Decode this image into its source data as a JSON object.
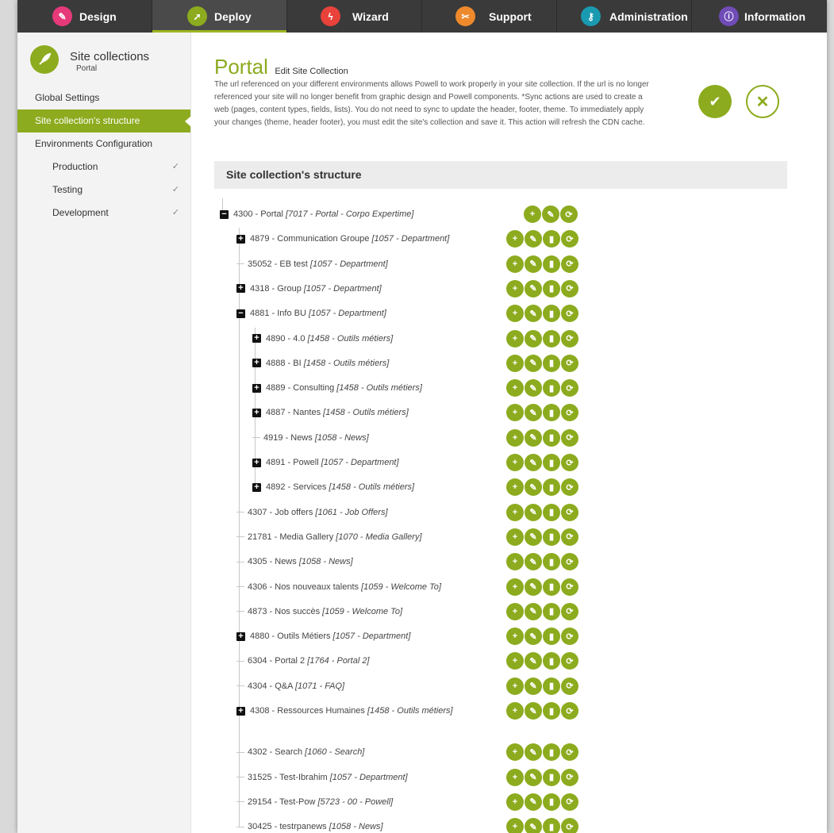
{
  "nav": {
    "tabs": [
      {
        "label": "Design",
        "icon": "wand-icon",
        "color": "#e6397a"
      },
      {
        "label": "Deploy",
        "icon": "rocket-icon",
        "color": "#8cab1e"
      },
      {
        "label": "Wizard",
        "icon": "lightning-icon",
        "color": "#e8423a"
      },
      {
        "label": "Support",
        "icon": "ticket-icon",
        "color": "#ee8a2c"
      },
      {
        "label": "Administration",
        "icon": "key-icon",
        "color": "#1a9ab0"
      },
      {
        "label": "Information",
        "icon": "info-icon",
        "color": "#6f4cb6"
      }
    ],
    "active": "Deploy"
  },
  "sidebar": {
    "title": "Site collections",
    "subtitle": "Portal",
    "items": [
      {
        "label": "Global Settings"
      },
      {
        "label": "Site collection's structure",
        "active": true
      },
      {
        "label": "Environments Configuration"
      },
      {
        "label": "Production",
        "check": "✓"
      },
      {
        "label": "Testing",
        "check": "✓"
      },
      {
        "label": "Development",
        "check": "✓"
      }
    ]
  },
  "main": {
    "title": "Portal",
    "subtitle": "Edit Site Collection",
    "description": "The url referenced on your different environments allows Powell to work properly in your site collection. If the url is no longer referenced your site will no longer benefit from graphic design and Powell components. *Sync actions are used to create a web (pages, content types, fields, lists). You do not need to sync to update the header, footer, theme. To immediately apply your changes (theme, header footer), you must edit the site's collection and save it. This action will refresh the CDN cache.",
    "section_title": "Site collection's structure"
  },
  "tree": {
    "nodes": [
      {
        "id": "4300",
        "name": "Portal",
        "cat": "[7017 - Portal - Corpo Expertime]",
        "toggle": "−",
        "level": 0
      },
      {
        "id": "4879",
        "name": "Communication Groupe",
        "cat": "[1057 - Department]",
        "toggle": "+",
        "level": 1
      },
      {
        "id": "35052",
        "name": "EB test",
        "cat": "[1057 - Department]",
        "level": 1
      },
      {
        "id": "4318",
        "name": "Group",
        "cat": "[1057 - Department]",
        "toggle": "+",
        "level": 1
      },
      {
        "id": "4881",
        "name": "Info BU",
        "cat": "[1057 - Department]",
        "toggle": "−",
        "level": 1
      },
      {
        "id": "4890",
        "name": "4.0",
        "cat": "[1458 - Outils métiers]",
        "toggle": "+",
        "level": 2
      },
      {
        "id": "4888",
        "name": "BI",
        "cat": "[1458 - Outils métiers]",
        "toggle": "+",
        "level": 2
      },
      {
        "id": "4889",
        "name": "Consulting",
        "cat": "[1458 - Outils métiers]",
        "toggle": "+",
        "level": 2
      },
      {
        "id": "4887",
        "name": "Nantes",
        "cat": "[1458 - Outils métiers]",
        "toggle": "+",
        "level": 2
      },
      {
        "id": "4919",
        "name": "News",
        "cat": "[1058 - News]",
        "level": 2
      },
      {
        "id": "4891",
        "name": "Powell",
        "cat": "[1057 - Department]",
        "toggle": "+",
        "level": 2
      },
      {
        "id": "4892",
        "name": "Services",
        "cat": "[1458 - Outils métiers]",
        "toggle": "+",
        "level": 2
      },
      {
        "id": "4307",
        "name": "Job offers",
        "cat": "[1061 - Job Offers]",
        "level": 1
      },
      {
        "id": "21781",
        "name": "Media Gallery",
        "cat": "[1070 - Media Gallery]",
        "level": 1
      },
      {
        "id": "4305",
        "name": "News",
        "cat": "[1058 - News]",
        "level": 1
      },
      {
        "id": "4306",
        "name": "Nos nouveaux talents",
        "cat": "[1059 - Welcome To]",
        "level": 1
      },
      {
        "id": "4873",
        "name": "Nos succès",
        "cat": "[1059 - Welcome To]",
        "level": 1
      },
      {
        "id": "4880",
        "name": "Outils Métiers",
        "cat": "[1057 - Department]",
        "toggle": "+",
        "level": 1
      },
      {
        "id": "6304",
        "name": "Portal 2",
        "cat": "[1764 - Portal 2]",
        "level": 1
      },
      {
        "id": "4304",
        "name": "Q&A",
        "cat": "[1071 - FAQ]",
        "level": 1
      },
      {
        "id": "4308",
        "name": "Ressources Humaines",
        "cat": "[1458 - Outils métiers]",
        "toggle": "+",
        "level": 1
      },
      {
        "id": "4302",
        "name": "Search",
        "cat": "[1060 - Search]",
        "level": 1
      },
      {
        "id": "31525",
        "name": "Test-Ibrahim",
        "cat": "[1057 - Department]",
        "level": 1
      },
      {
        "id": "29154",
        "name": "Test-Pow",
        "cat": "[5723 - 00 - Powell]",
        "level": 1
      },
      {
        "id": "30425",
        "name": "testrpanews",
        "cat": "[1058 - News]",
        "level": 1
      }
    ]
  },
  "accent_color": "#8cab1e"
}
